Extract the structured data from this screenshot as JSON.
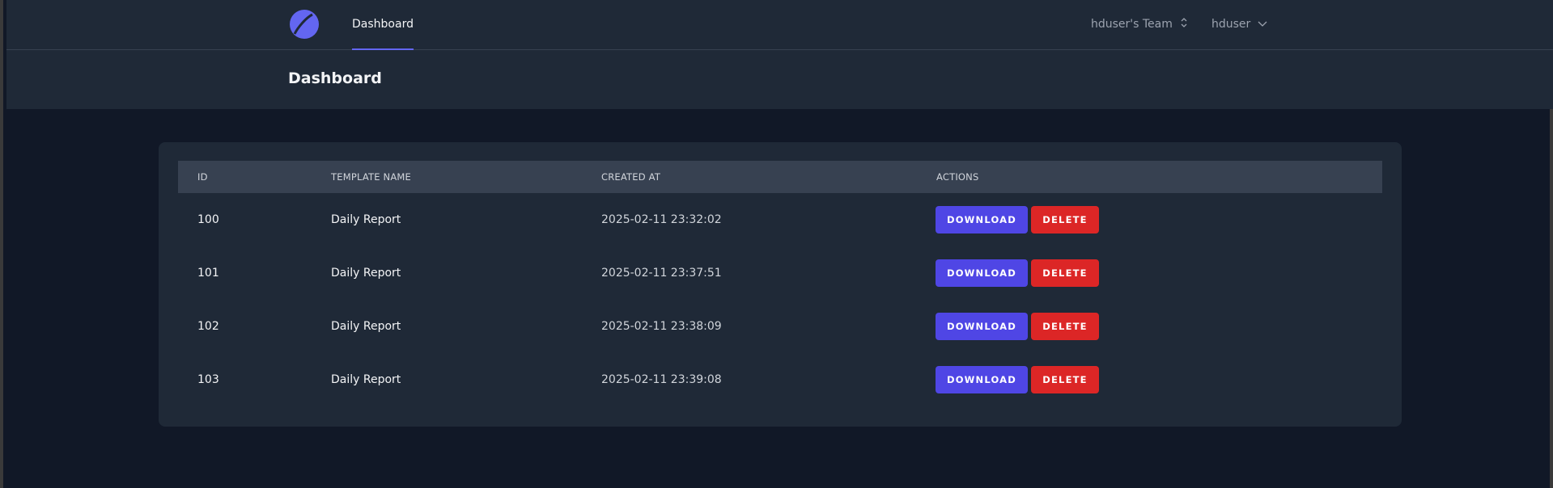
{
  "nav": {
    "tab_label": "Dashboard",
    "team_label": "hduser's Team",
    "user_label": "hduser",
    "logo_icon": "logo-icon",
    "accent": "#6366f1"
  },
  "header": {
    "title": "Dashboard"
  },
  "table": {
    "columns": [
      "ID",
      "TEMPLATE NAME",
      "CREATED AT",
      "ACTIONS"
    ],
    "rows": [
      {
        "id": "100",
        "template_name": "Daily Report",
        "created_at": "2025-02-11 23:32:02",
        "download_label": "DOWNLOAD",
        "delete_label": "DELETE"
      },
      {
        "id": "101",
        "template_name": "Daily Report",
        "created_at": "2025-02-11 23:37:51",
        "download_label": "DOWNLOAD",
        "delete_label": "DELETE"
      },
      {
        "id": "102",
        "template_name": "Daily Report",
        "created_at": "2025-02-11 23:38:09",
        "download_label": "DOWNLOAD",
        "delete_label": "DELETE"
      },
      {
        "id": "103",
        "template_name": "Daily Report",
        "created_at": "2025-02-11 23:39:08",
        "download_label": "DOWNLOAD",
        "delete_label": "DELETE"
      }
    ]
  },
  "colors": {
    "download": "#4f46e5",
    "delete": "#dc2626",
    "background": "#111827",
    "surface": "#1f2937"
  }
}
